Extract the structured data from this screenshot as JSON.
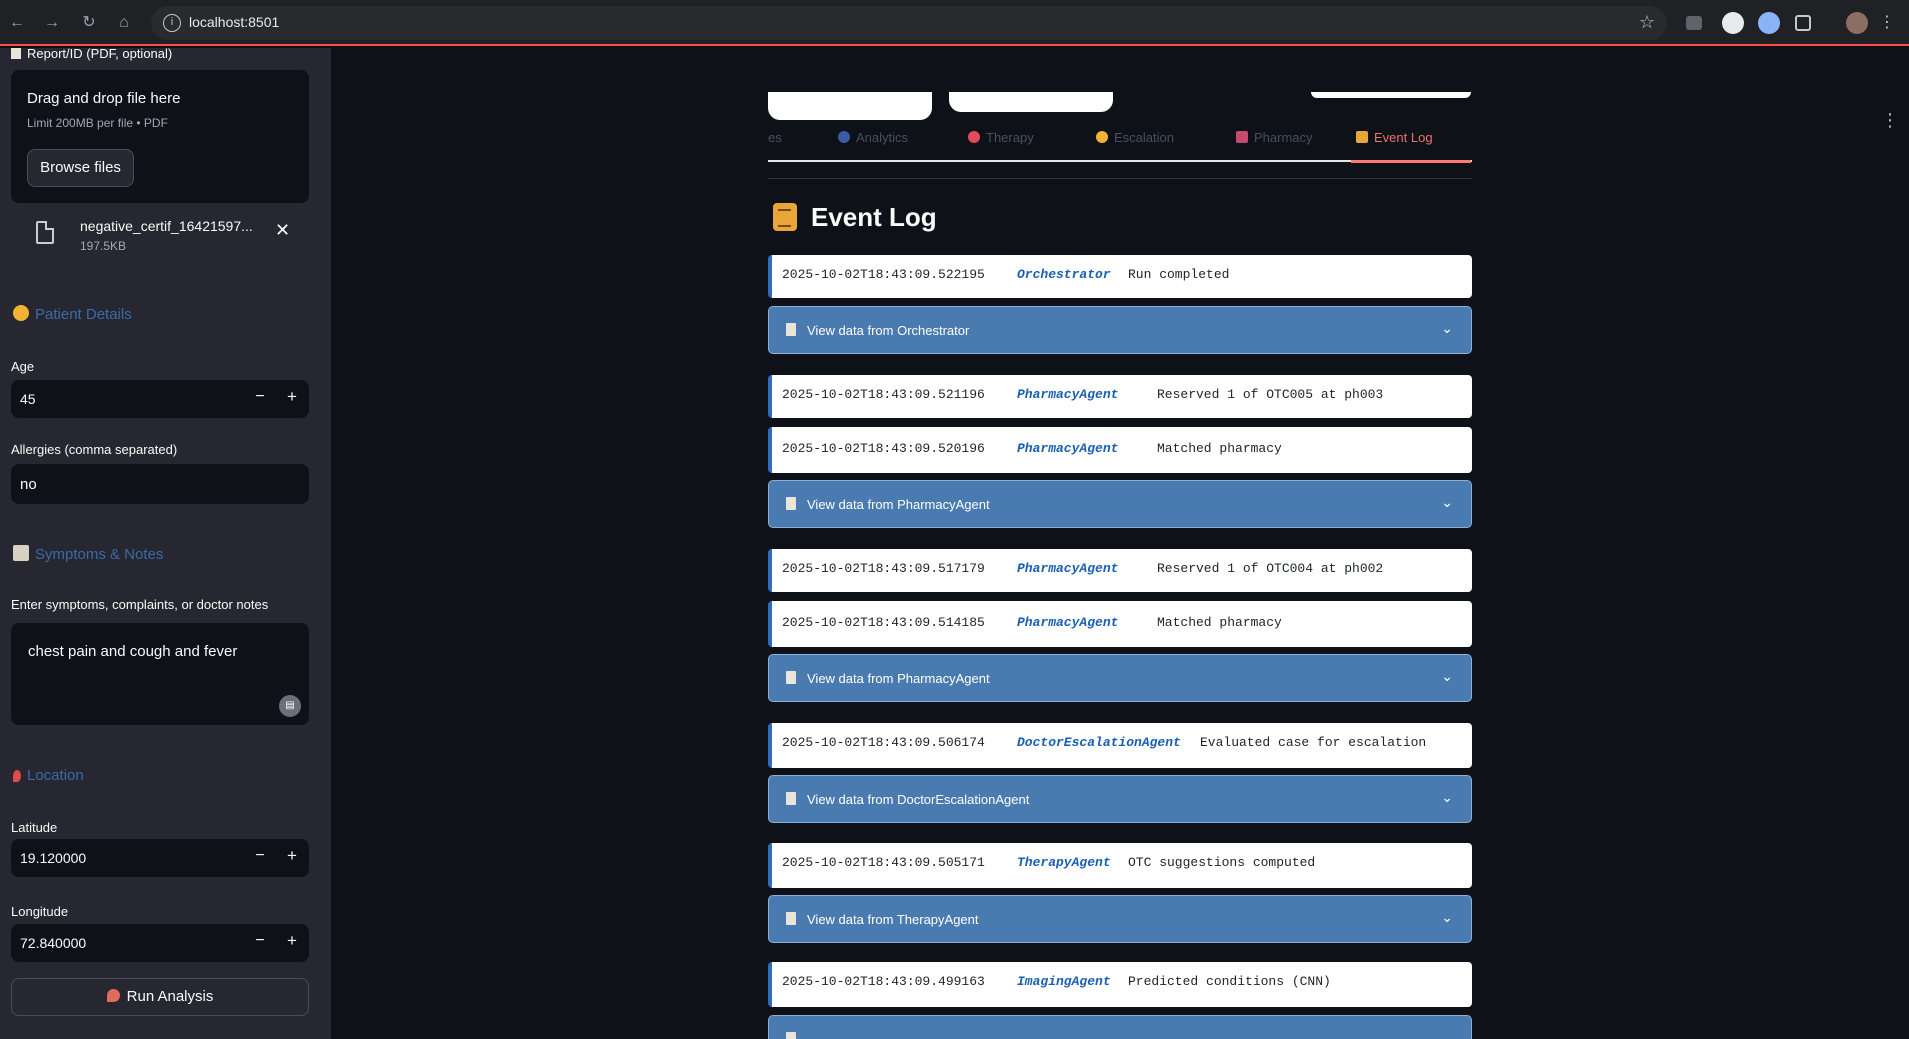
{
  "browser": {
    "url": "localhost:8501"
  },
  "sidebar": {
    "report_label": "Report/ID (PDF, optional)",
    "uploader_title": "Drag and drop file here",
    "uploader_limit": "Limit 200MB per file • PDF",
    "browse_label": "Browse files",
    "file_name": "negative_certif_16421597...",
    "file_size": "197.5KB",
    "patient_header": "Patient Details",
    "age_label": "Age",
    "age_value": "45",
    "allergies_label": "Allergies (comma separated)",
    "allergies_value": "no",
    "symptoms_header": "Symptoms & Notes",
    "symptoms_label": "Enter symptoms, complaints, or doctor notes",
    "symptoms_value": "chest pain and cough and fever",
    "location_header": "Location",
    "latitude_label": "Latitude",
    "latitude_value": "19.120000",
    "longitude_label": "Longitude",
    "longitude_value": "72.840000",
    "run_label": "Run Analysis"
  },
  "tabs": [
    {
      "label": "es",
      "active": false
    },
    {
      "label": "Analytics",
      "active": false,
      "icon": "analytics-icon"
    },
    {
      "label": "Therapy",
      "active": false,
      "icon": "pill-icon"
    },
    {
      "label": "Escalation",
      "active": false,
      "icon": "doctor-icon"
    },
    {
      "label": "Pharmacy",
      "active": false,
      "icon": "pharmacy-icon"
    },
    {
      "label": "Event Log",
      "active": true,
      "icon": "scroll-icon"
    }
  ],
  "main": {
    "title": "Event Log"
  },
  "log": [
    {
      "ts": "2025-10-02T18:43:09.522195",
      "agent": "Orchestrator",
      "msg": "Run completed"
    },
    {
      "expander": "View data from Orchestrator"
    },
    {
      "ts": "2025-10-02T18:43:09.521196",
      "agent": "PharmacyAgent",
      "msg": "Reserved 1 of OTC005 at ph003"
    },
    {
      "ts": "2025-10-02T18:43:09.520196",
      "agent": "PharmacyAgent",
      "msg": "Matched pharmacy"
    },
    {
      "expander": "View data from PharmacyAgent"
    },
    {
      "ts": "2025-10-02T18:43:09.517179",
      "agent": "PharmacyAgent",
      "msg": "Reserved 1 of OTC004 at ph002"
    },
    {
      "ts": "2025-10-02T18:43:09.514185",
      "agent": "PharmacyAgent",
      "msg": "Matched pharmacy"
    },
    {
      "expander": "View data from PharmacyAgent"
    },
    {
      "ts": "2025-10-02T18:43:09.506174",
      "agent": "DoctorEscalationAgent",
      "msg": "Evaluated case for escalation"
    },
    {
      "expander": "View data from DoctorEscalationAgent"
    },
    {
      "ts": "2025-10-02T18:43:09.505171",
      "agent": "TherapyAgent",
      "msg": "OTC suggestions computed"
    },
    {
      "expander": "View data from TherapyAgent"
    },
    {
      "ts": "2025-10-02T18:43:09.499163",
      "agent": "ImagingAgent",
      "msg": "Predicted conditions (CNN)"
    }
  ],
  "colors": {
    "accent": "#ff4b4b",
    "expander_bg": "#4a7bb0",
    "agent_text": "#1a5fb4",
    "section_header": "#3a6aa8"
  }
}
